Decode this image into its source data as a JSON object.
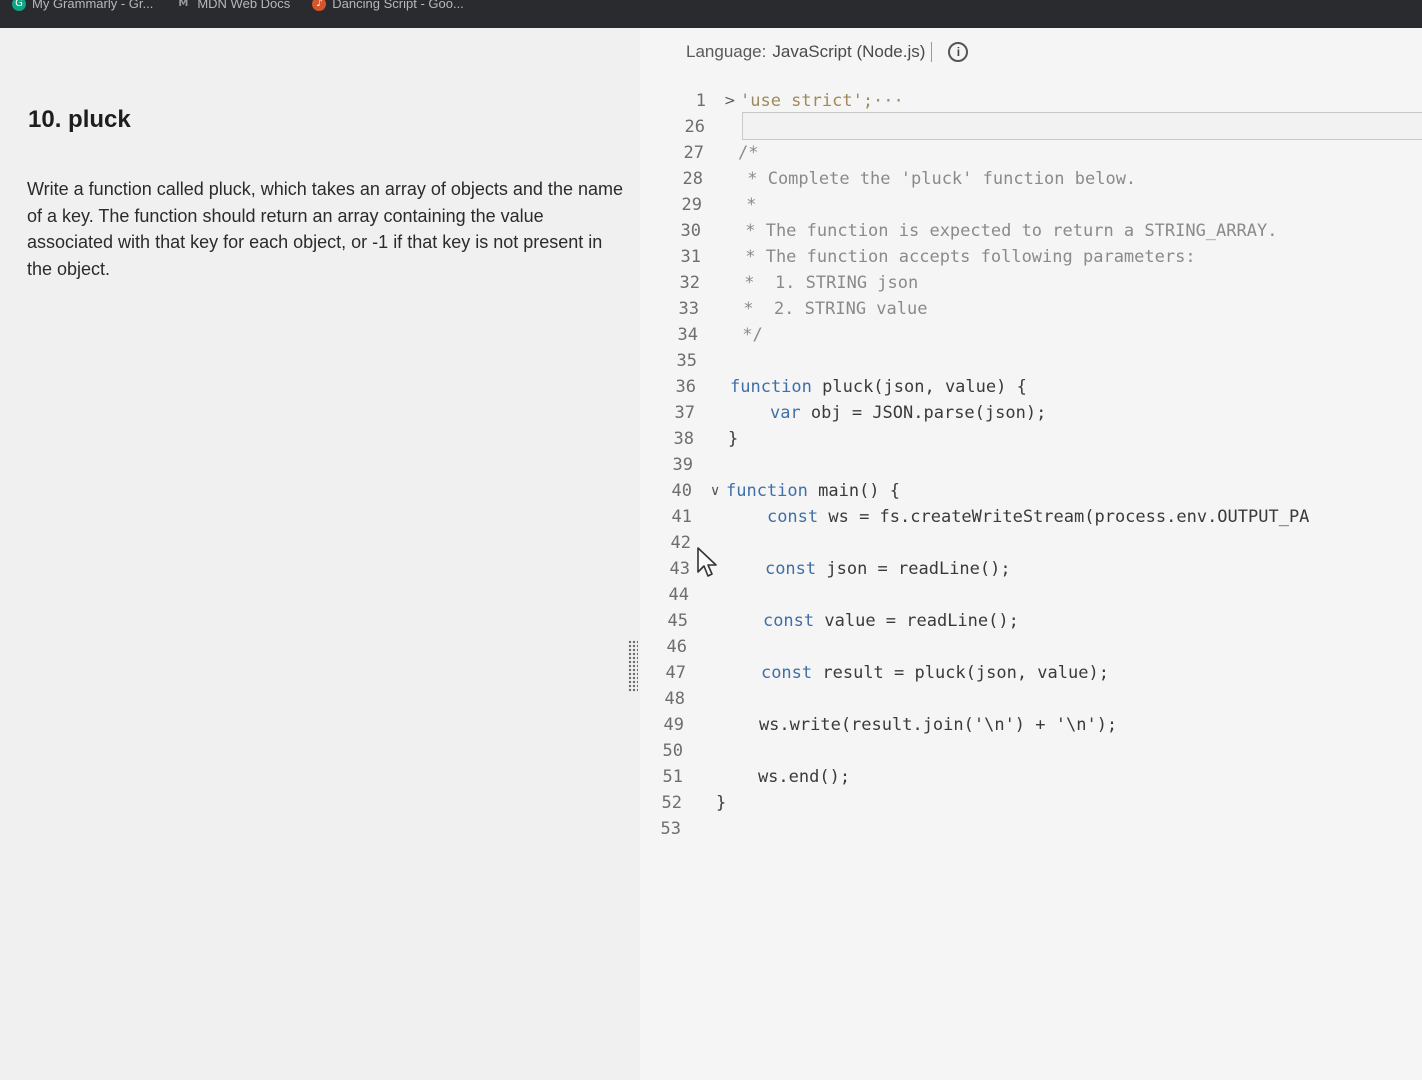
{
  "bookmarks": [
    {
      "label": "My Grammarly - Gr...",
      "icon": "grammarly-icon"
    },
    {
      "label": "MDN Web Docs",
      "icon": "mdn-icon"
    },
    {
      "label": "Dancing Script - Goo...",
      "icon": "dance-icon"
    }
  ],
  "problem": {
    "title": "10. pluck",
    "description": "Write a function called pluck, which takes an array of objects and the name of a key. The function should return an array containing the value associated with that key for each object, or -1 if that key is not present in the object."
  },
  "editor": {
    "language_label": "Language:",
    "language_value": "JavaScript (Node.js)",
    "lines": [
      {
        "n": "1",
        "fold": ">",
        "text": "'use strict';···",
        "cls": "str"
      },
      {
        "n": "26",
        "fold": "",
        "text": "",
        "cls": ""
      },
      {
        "n": "27",
        "fold": "",
        "text": "/*",
        "cls": "cmt"
      },
      {
        "n": "28",
        "fold": "",
        "text": " * Complete the 'pluck' function below.",
        "cls": "cmt"
      },
      {
        "n": "29",
        "fold": "",
        "text": " *",
        "cls": "cmt"
      },
      {
        "n": "30",
        "fold": "",
        "text": " * The function is expected to return a STRING_ARRAY.",
        "cls": "cmt"
      },
      {
        "n": "31",
        "fold": "",
        "text": " * The function accepts following parameters:",
        "cls": "cmt"
      },
      {
        "n": "32",
        "fold": "",
        "text": " *  1. STRING json",
        "cls": "cmt"
      },
      {
        "n": "33",
        "fold": "",
        "text": " *  2. STRING value",
        "cls": "cmt"
      },
      {
        "n": "34",
        "fold": "",
        "text": " */",
        "cls": "cmt"
      },
      {
        "n": "35",
        "fold": "",
        "text": "",
        "cls": ""
      },
      {
        "n": "36",
        "fold": "",
        "text": "function pluck(json, value) {",
        "cls": ""
      },
      {
        "n": "37",
        "fold": "",
        "text": "    var obj = JSON.parse(json);",
        "cls": ""
      },
      {
        "n": "38",
        "fold": "",
        "text": "}",
        "cls": ""
      },
      {
        "n": "39",
        "fold": "",
        "text": "",
        "cls": ""
      },
      {
        "n": "40",
        "fold": "∨",
        "text": "function main() {",
        "cls": ""
      },
      {
        "n": "41",
        "fold": "",
        "text": "    const ws = fs.createWriteStream(process.env.OUTPUT_PA",
        "cls": ""
      },
      {
        "n": "42",
        "fold": "",
        "text": "",
        "cls": ""
      },
      {
        "n": "43",
        "fold": "",
        "text": "    const json = readLine();",
        "cls": ""
      },
      {
        "n": "44",
        "fold": "",
        "text": "",
        "cls": ""
      },
      {
        "n": "45",
        "fold": "",
        "text": "    const value = readLine();",
        "cls": ""
      },
      {
        "n": "46",
        "fold": "",
        "text": "",
        "cls": ""
      },
      {
        "n": "47",
        "fold": "",
        "text": "    const result = pluck(json, value);",
        "cls": ""
      },
      {
        "n": "48",
        "fold": "",
        "text": "",
        "cls": ""
      },
      {
        "n": "49",
        "fold": "",
        "text": "    ws.write(result.join('\\n') + '\\n');",
        "cls": ""
      },
      {
        "n": "50",
        "fold": "",
        "text": "",
        "cls": ""
      },
      {
        "n": "51",
        "fold": "",
        "text": "    ws.end();",
        "cls": ""
      },
      {
        "n": "52",
        "fold": "",
        "text": "}",
        "cls": ""
      },
      {
        "n": "53",
        "fold": "",
        "text": "",
        "cls": ""
      }
    ]
  }
}
